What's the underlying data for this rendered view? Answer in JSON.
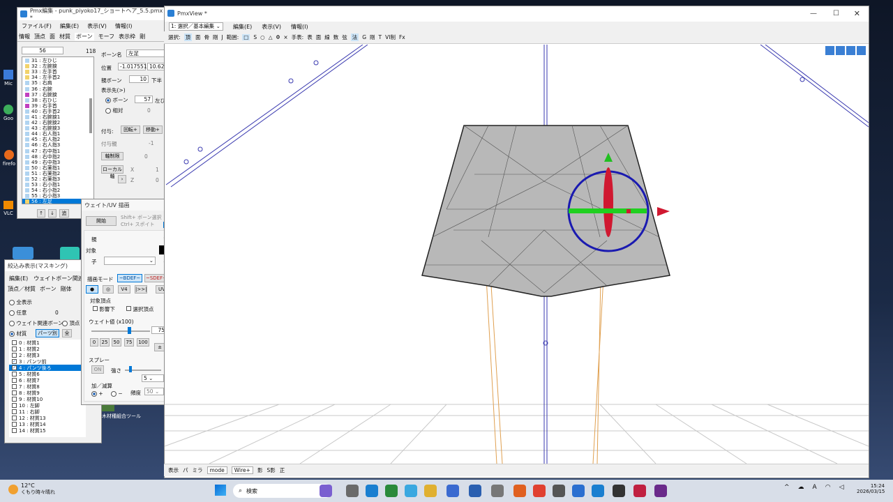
{
  "desktop": {
    "icons": [
      "Mic",
      "Goo",
      "firefo",
      "VLC"
    ],
    "shortcut_label": "木材種組合ツール"
  },
  "pmx_editor": {
    "title": "Pmx編集 - punk_piyoko17_ショートヘア_5.5.pmx *",
    "menu": [
      "ファイル(F)",
      "編集(E)",
      "表示(V)",
      "情報(I)"
    ],
    "tabs": [
      "情報",
      "頂点",
      "面",
      "材質",
      "ボーン",
      "モーフ",
      "表示枠",
      "剛"
    ],
    "index_value": "56",
    "count_value": "118",
    "bones": [
      "31 : 左ひじ",
      "32 : 左腕捩",
      "33 : 左手首",
      "34 : 左手首2",
      "35 : 右肩",
      "36 : 右腕",
      "37 : 右腕捩",
      "38 : 右ひじ",
      "39 : 右手首",
      "40 : 右手首2",
      "41 : 右腕捩1",
      "42 : 右腕捩2",
      "43 : 右腕捩3",
      "44 : 右人指1",
      "45 : 右人指2",
      "46 : 右人指3",
      "47 : 右中指1",
      "48 : 右中指2",
      "49 : 右中指3",
      "50 : 右薬指1",
      "51 : 右薬指2",
      "52 : 右薬指3",
      "53 : 右小指1",
      "54 : 右小指2",
      "55 : 右小指3",
      "56 : 左足"
    ],
    "bone_colors": [
      "#b0d4f1",
      "#f2d36b",
      "#f2d36b",
      "#f2d36b",
      "#b0d4f1",
      "#b0d4f1",
      "#c040c0",
      "#b0d4f1",
      "#c040c0",
      "#b0d4f1",
      "#b0d4f1",
      "#b0d4f1",
      "#b0d4f1",
      "#b0d4f1",
      "#b0d4f1",
      "#b0d4f1",
      "#b0d4f1",
      "#b0d4f1",
      "#b0d4f1",
      "#b0d4f1",
      "#b0d4f1",
      "#b0d4f1",
      "#b0d4f1",
      "#b0d4f1",
      "#b0d4f1",
      "#f2d36b"
    ],
    "bone_name_label": "ボーン名",
    "bone_name_value": "左足",
    "pos_label": "位置",
    "pos_x": "-1.017551",
    "pos_y": "10.623",
    "parent_label": "親ボーン",
    "parent_value": "10",
    "parent_suffix": "下半",
    "display_label": "表示先(>)",
    "bone_radio": "ボーン",
    "bone_radio_value": "57",
    "bone_suffix": "左ひ",
    "relative_radio": "相対",
    "relative_value": "0",
    "grant_label": "付与:",
    "rotate_btn": "回転+",
    "move_btn": "移動+",
    "grant_parent_label": "付与親",
    "grant_parent_value": "-1",
    "fixed_axis": "軸制限",
    "fixed_value": "0",
    "local_axis": "ローカル軸",
    "x_label": "X",
    "x_value": "1",
    "z_label": "Z",
    "z_value": "0",
    "bottom_btns": [
      "↑",
      "↓",
      "追"
    ]
  },
  "weight_panel": {
    "title": "ウェイト/UV 描画",
    "start_btn": "開始",
    "shift_text": "Shift+ ボーン選択",
    "ctrl_text": "Ctrl+ スポイト",
    "parent_label": "親",
    "target_label": "対象",
    "child_label": "子",
    "mode_label": "描画モード",
    "mode_on": "~BDEF~",
    "mode_off": "~SDEF~",
    "tool_btns": [
      "●",
      "◎",
      "V4",
      "|>>|",
      "UV"
    ],
    "target_vertex": "対象頂点",
    "back_check": "影響下",
    "sel_check": "選択頂点",
    "weight_label": "ウェイト値 (x100)",
    "weight_value": "75",
    "presets": [
      "0",
      "25",
      "50",
      "75",
      "100"
    ],
    "spray_label": "スプレー",
    "on_btn": "ON",
    "strength_label": "強さ",
    "strength_value": "5",
    "addsub_label": "加／減算",
    "plus": "+",
    "minus": "−",
    "freq_label": "頻度",
    "freq_value": "50"
  },
  "mask_panel": {
    "title": "絞込み表示(マスキング)",
    "menu": [
      "編集(E)",
      "ウェイトボーン関連(B)"
    ],
    "tabs": [
      "頂点／材質",
      "ボーン",
      "剛体"
    ],
    "opt_all": "全表示",
    "opt_any": "任意",
    "opt_any_value": "0",
    "opt_weight": "ウェイト関連ボーン",
    "opt_vertex": "頂点",
    "opt_material": "材質",
    "btn_parts": "パーツ別",
    "btn_all": "全",
    "materials": [
      "0 : 材質1",
      "1 : 材質2",
      "2 : 材質3",
      "3 : パンツ前",
      "4 : パンツ後ろ",
      "5 : 材質6",
      "6 : 材質7",
      "7 : 材質8",
      "8 : 材質9",
      "9 : 材質10",
      "10 : 左脚",
      "11 : 右脚",
      "12 : 材質13",
      "13 : 材質14",
      "14 : 材質15"
    ],
    "checked": [
      3,
      4
    ],
    "selected": 4
  },
  "pmxview": {
    "title": "PmxView *",
    "mode_select": "1: 選択／基本編集",
    "menu": [
      "編集(E)",
      "表示(V)",
      "情報(I)"
    ],
    "toolbar1": [
      "選択:",
      "頂",
      "面",
      "骨",
      "剛",
      "J",
      "範囲:",
      "□",
      "S",
      "○",
      "△",
      "Φ",
      "×",
      "手表:",
      "表",
      "面",
      "線",
      "数",
      "弦",
      "法",
      "G",
      "剛",
      "T"
    ],
    "vi_label": "VI制",
    "fx_label": "Fx",
    "bottom": [
      "表示",
      "パ",
      "ミラ",
      "mode",
      "Wire+",
      "影",
      "S影",
      "正"
    ]
  },
  "taskbar": {
    "weather_temp": "12°C",
    "weather_desc": "くもり時々晴れ",
    "search": "検索",
    "time": "15:24",
    "date": "2026/03/15",
    "ime": "A"
  }
}
